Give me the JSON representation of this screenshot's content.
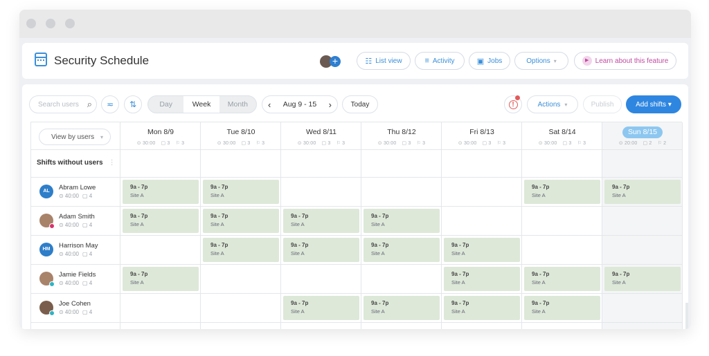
{
  "header": {
    "title": "Security Schedule",
    "buttons": [
      {
        "id": "list-view",
        "label": "List view",
        "icon": "list-icon",
        "glyph": "☷"
      },
      {
        "id": "activity",
        "label": "Activity",
        "icon": "activity-lines-icon",
        "glyph": "≡"
      },
      {
        "id": "jobs",
        "label": "Jobs",
        "icon": "briefcase-icon",
        "glyph": "▣"
      },
      {
        "id": "options",
        "label": "Options",
        "icon": "chevron-down-icon",
        "glyph": "▾"
      },
      {
        "id": "learn",
        "label": "Learn about this feature",
        "icon": "play-icon",
        "glyph": "▶"
      }
    ],
    "add_glyph": "+"
  },
  "toolbar": {
    "search_placeholder": "Search users",
    "search_glyph": "⌕",
    "filter_glyph": "≂",
    "sort_glyph": "⇅",
    "views": [
      "Day",
      "Week",
      "Month"
    ],
    "active_view": "Week",
    "prev_glyph": "‹",
    "next_glyph": "›",
    "date_range": "Aug 9 - 15",
    "today_label": "Today",
    "alert_glyph": "!",
    "actions_label": "Actions",
    "actions_caret": "▾",
    "publish_label": "Publish",
    "add_shifts_label": "Add shifts ▾"
  },
  "grid": {
    "view_by_label": "View by users",
    "view_by_caret": "▾",
    "unassigned_label": "Shifts without users",
    "more_glyph": "⋮",
    "days": [
      {
        "name": "Mon 8/9",
        "hours": "⊙ 30:00",
        "shifts": "▢ 3",
        "users": "⚐ 3"
      },
      {
        "name": "Tue 8/10",
        "hours": "⊙ 30:00",
        "shifts": "▢ 3",
        "users": "⚐ 3"
      },
      {
        "name": "Wed 8/11",
        "hours": "⊙ 30:00",
        "shifts": "▢ 3",
        "users": "⚐ 3"
      },
      {
        "name": "Thu 8/12",
        "hours": "⊙ 30:00",
        "shifts": "▢ 3",
        "users": "⚐ 3"
      },
      {
        "name": "Fri 8/13",
        "hours": "⊙ 30:00",
        "shifts": "▢ 3",
        "users": "⚐ 3"
      },
      {
        "name": "Sat 8/14",
        "hours": "⊙ 30:00",
        "shifts": "▢ 3",
        "users": "⚐ 3"
      },
      {
        "name": "Sun 8/15",
        "hours": "⊙ 20:00",
        "shifts": "▢ 2",
        "users": "⚐ 2",
        "today": true
      }
    ],
    "employees": [
      {
        "name": "Abram Lowe",
        "initials": "AL",
        "avatar": "initials",
        "hours": "⊙ 40:00",
        "shifts": "▢ 4",
        "days": [
          0,
          1,
          5,
          6
        ]
      },
      {
        "name": "Adam Smith",
        "initials": "",
        "avatar": "photo",
        "status_color": "#d6336c",
        "hours": "⊙ 40:00",
        "shifts": "▢ 4",
        "days": [
          0,
          1,
          2,
          3
        ]
      },
      {
        "name": "Harrison May",
        "initials": "HM",
        "avatar": "initials",
        "hours": "⊙ 40:00",
        "shifts": "▢ 4",
        "days": [
          1,
          2,
          3,
          4
        ]
      },
      {
        "name": "Jamie Fields",
        "initials": "",
        "avatar": "photo",
        "status_color": "#2fb3c2",
        "hours": "⊙ 40:00",
        "shifts": "▢ 4",
        "days": [
          0,
          4,
          5,
          6
        ]
      },
      {
        "name": "Joe Cohen",
        "initials": "",
        "avatar": "photo",
        "status_color": "#2fb3c2",
        "hours": "⊙ 40:00",
        "shifts": "▢ 4",
        "days": [
          2,
          3,
          4,
          5
        ]
      }
    ],
    "shift": {
      "time": "9a - 7p",
      "site": "Site A"
    }
  },
  "colors": {
    "accent": "#2f86e0",
    "shift_bg": "#dde8d8",
    "learn": "#c04aa0"
  }
}
